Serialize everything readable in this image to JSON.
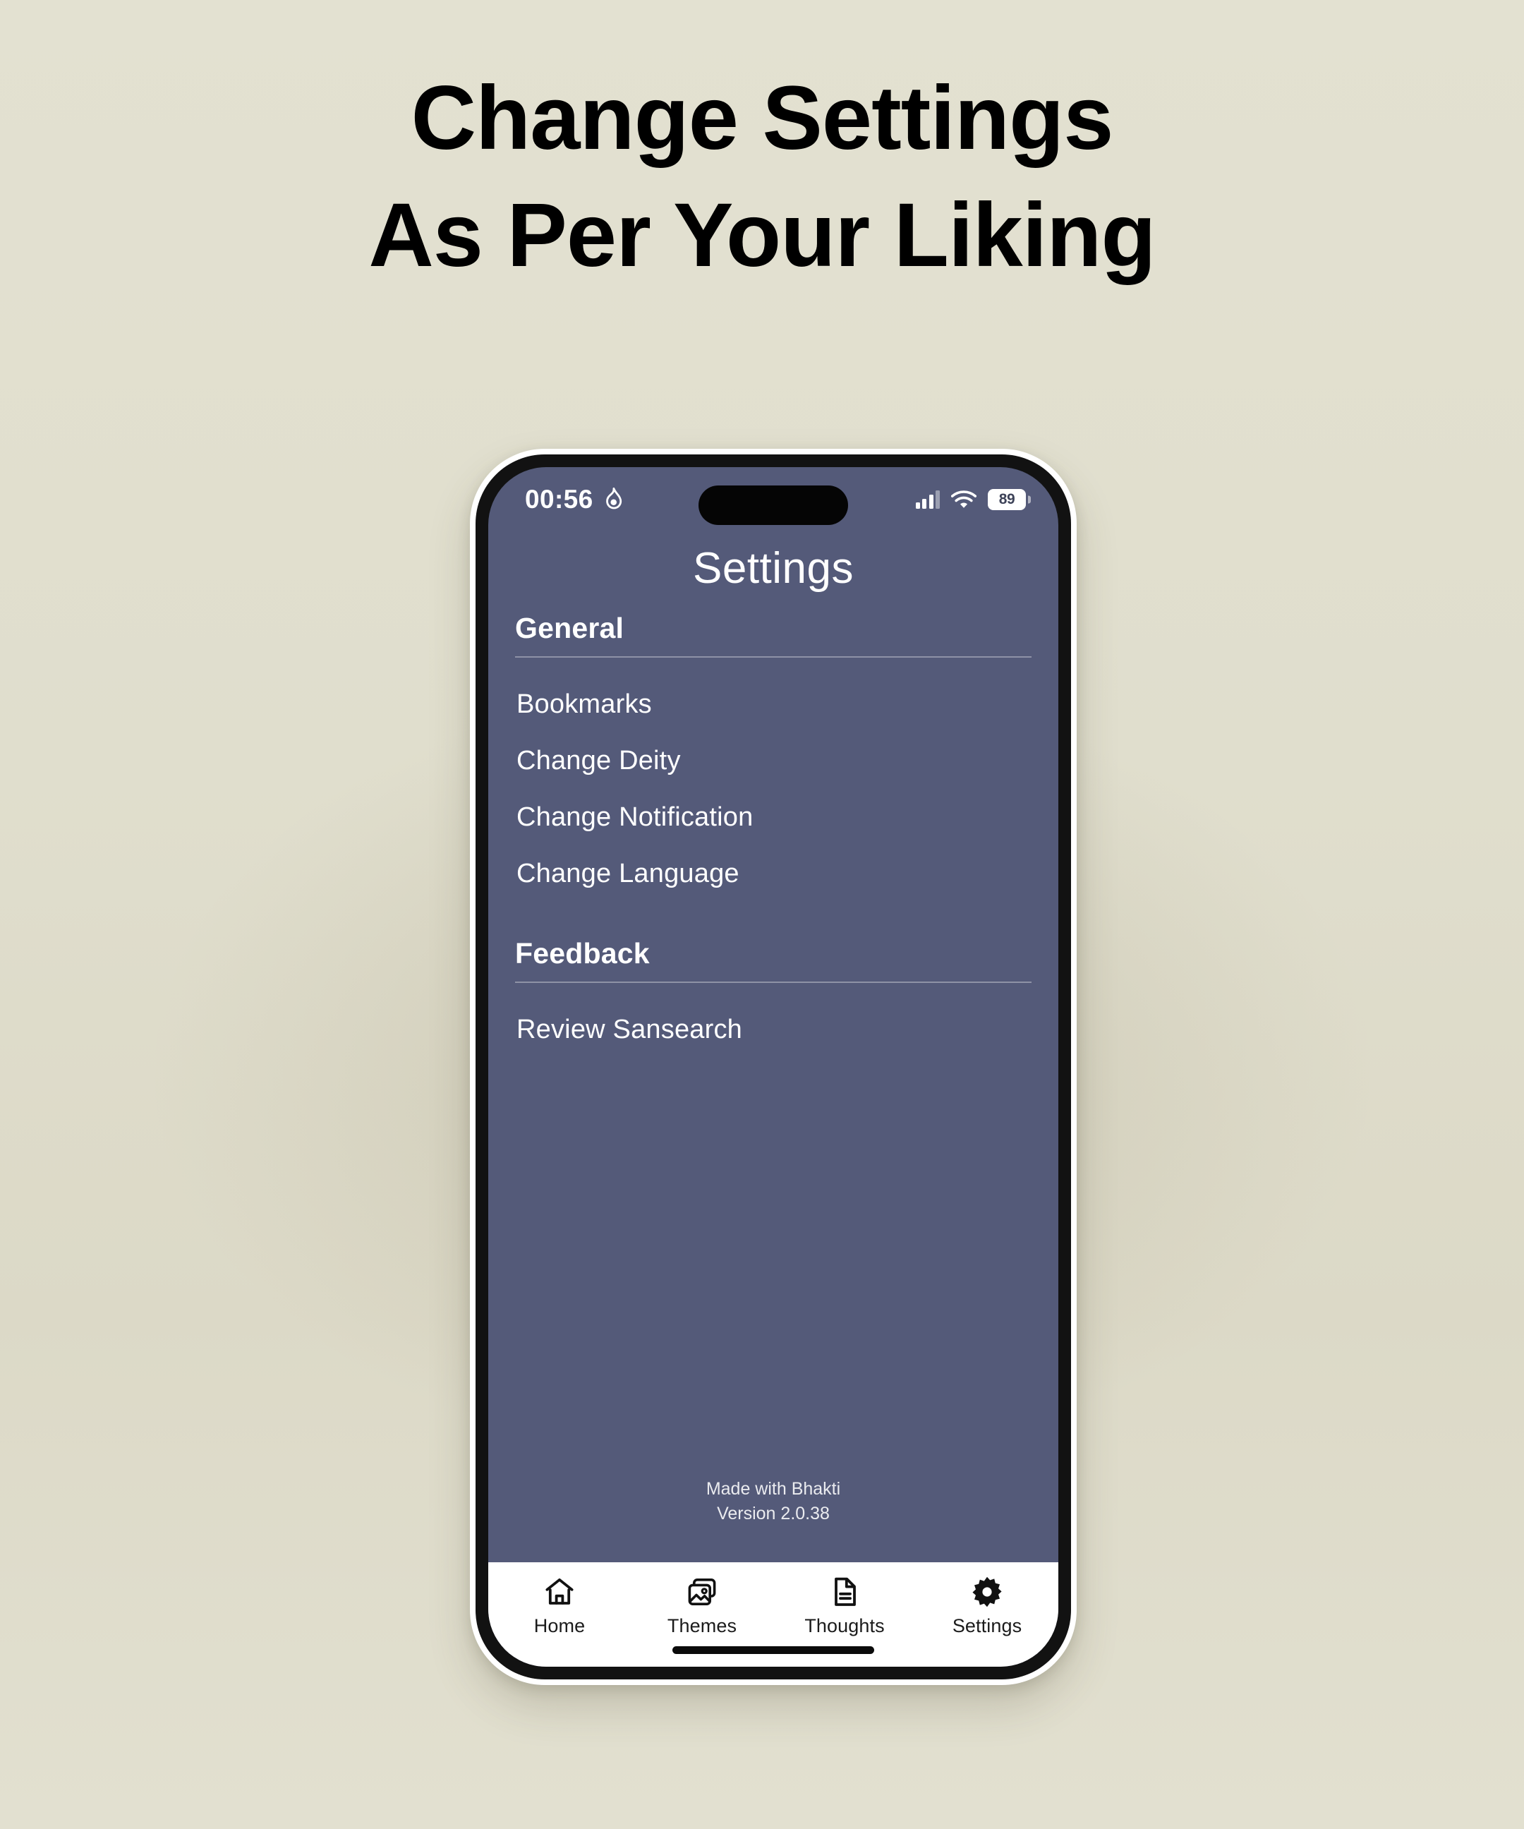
{
  "promo": {
    "headline_line1": "Change Settings",
    "headline_line2": "As Per Your Liking",
    "background_color": "#e0decd",
    "text_color": "#000000"
  },
  "phone": {
    "status_bar": {
      "time": "00:56",
      "focus_icon": "flame-icon",
      "signal_icon": "cellular-signal-icon",
      "wifi_icon": "wifi-icon",
      "battery_level": "89"
    },
    "screen_background_color": "#545a79",
    "accent_text_color": "#ffffff"
  },
  "app": {
    "title": "Settings",
    "sections": [
      {
        "header": "General",
        "items": [
          {
            "label": "Bookmarks"
          },
          {
            "label": "Change Deity"
          },
          {
            "label": "Change Notification"
          },
          {
            "label": "Change Language"
          }
        ]
      },
      {
        "header": "Feedback",
        "items": [
          {
            "label": "Review Sansearch"
          }
        ]
      }
    ],
    "footer": {
      "made_with": "Made with Bhakti",
      "version": "Version 2.0.38"
    },
    "tabs": [
      {
        "label": "Home",
        "icon": "home-icon",
        "active": false
      },
      {
        "label": "Themes",
        "icon": "image-gallery-icon",
        "active": false
      },
      {
        "label": "Thoughts",
        "icon": "document-icon",
        "active": false
      },
      {
        "label": "Settings",
        "icon": "gear-icon",
        "active": true
      }
    ]
  }
}
